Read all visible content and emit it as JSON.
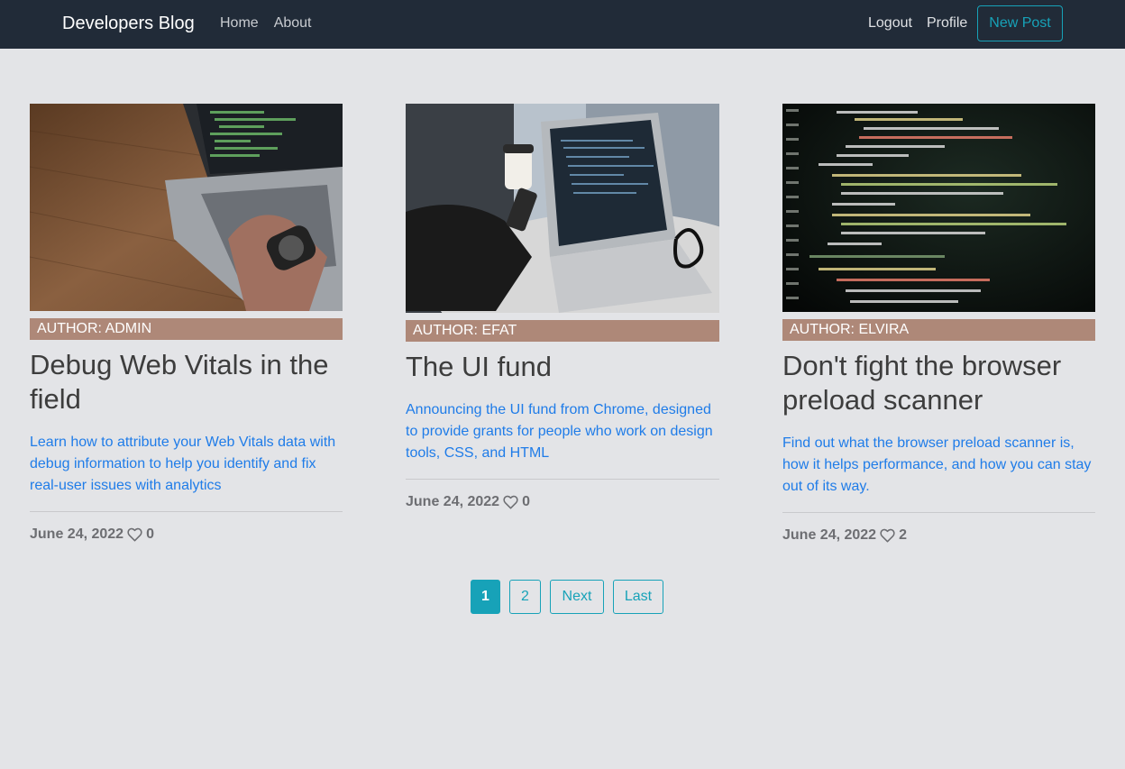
{
  "nav": {
    "brand": "Developers Blog",
    "left_links": [
      "Home",
      "About"
    ],
    "logout": "Logout",
    "profile": "Profile",
    "new_post": "New Post"
  },
  "posts": [
    {
      "author": "AUTHOR: ADMIN",
      "title": "Debug Web Vitals in the field",
      "excerpt": "Learn how to attribute your Web Vitals data with debug information to help you identify and fix real-user issues with analytics",
      "date": "June 24, 2022",
      "likes": "0"
    },
    {
      "author": "AUTHOR: EFAT",
      "title": "The UI fund",
      "excerpt": "Announcing the UI fund from Chrome, designed to provide grants for people who work on design tools, CSS, and HTML",
      "date": "June 24, 2022",
      "likes": "0"
    },
    {
      "author": "AUTHOR: ELVIRA",
      "title": "Don't fight the browser preload scanner",
      "excerpt": "Find out what the browser preload scanner is, how it helps performance, and how you can stay out of its way.",
      "date": "June 24, 2022",
      "likes": "2"
    }
  ],
  "pagination": {
    "page1": "1",
    "page2": "2",
    "next": "Next",
    "last": "Last"
  },
  "colors": {
    "navbar": "#212b38",
    "accent": "#17a2b8",
    "author_badge": "#ae8878",
    "link": "#1f7ce8"
  }
}
